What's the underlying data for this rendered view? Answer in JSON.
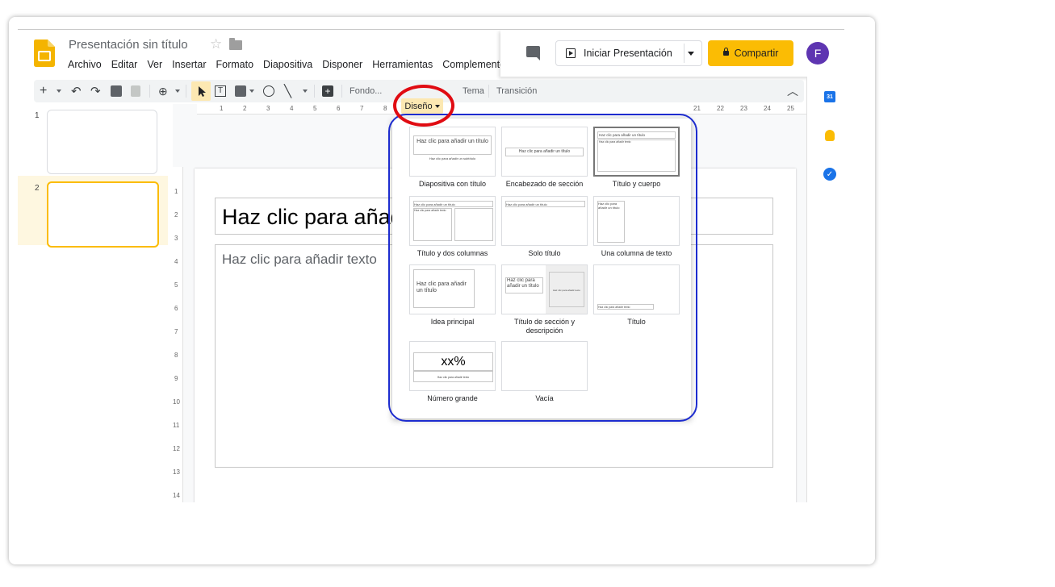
{
  "header": {
    "doc_title": "Presentación sin título",
    "menu": [
      "Archivo",
      "Editar",
      "Ver",
      "Insertar",
      "Formato",
      "Diapositiva",
      "Disponer",
      "Herramientas",
      "Complementos"
    ]
  },
  "actions": {
    "present_label": "Iniciar Presentación",
    "share_label": "Compartir",
    "avatar_letter": "F"
  },
  "toolbar": {
    "fondo_label": "Fondo...",
    "diseno_label": "Diseño",
    "tema_label": "Tema",
    "transicion_label": "Transición"
  },
  "filmstrip": {
    "slides": [
      {
        "number": "1"
      },
      {
        "number": "2"
      }
    ]
  },
  "ruler": {
    "top_ticks": [
      "1",
      "2",
      "3",
      "4",
      "5",
      "6",
      "7",
      "8",
      "21",
      "22",
      "23",
      "24",
      "25"
    ],
    "left_ticks": [
      "1",
      "2",
      "3",
      "4",
      "5",
      "6",
      "7",
      "8",
      "9",
      "10",
      "11",
      "12",
      "13",
      "14"
    ]
  },
  "slide": {
    "title_placeholder": "Haz clic para añadir un título",
    "body_placeholder": "Haz clic para añadir texto"
  },
  "layouts": {
    "items": [
      {
        "label": "Diapositiva con título",
        "preview_title": "Haz clic para añadir un título",
        "preview_sub": "Haz clic para añadir un subtítulo"
      },
      {
        "label": "Encabezado de sección",
        "preview_title": "Haz clic para añadir un título"
      },
      {
        "label": "Título y cuerpo",
        "preview_title": "Haz clic para añadir un título",
        "preview_sub": "Haz clic para añadir texto"
      },
      {
        "label": "Título y dos columnas",
        "preview_title": "Haz clic para añadir un título",
        "preview_sub": "Haz clic para añadir texto"
      },
      {
        "label": "Solo título",
        "preview_title": "Haz clic para añadir un título"
      },
      {
        "label": "Una columna de texto",
        "preview_title": "Haz clic para añadir un título"
      },
      {
        "label": "Idea principal",
        "preview_title": "Haz clic para añadir un título"
      },
      {
        "label": "Título de sección y descripción",
        "preview_title": "Haz clic para añadir un título",
        "preview_sub": "Haz clic para añadir texto"
      },
      {
        "label": "Título",
        "preview_sub": "Haz clic para añadir texto"
      },
      {
        "label": "Número grande",
        "preview_title": "xx%",
        "preview_sub": "Haz clic para añadir texto"
      },
      {
        "label": "Vacía"
      }
    ]
  },
  "colors": {
    "accent": "#fbbc04",
    "highlight_circle_red": "#e00b12",
    "highlight_circle_blue": "#1d2ccf",
    "avatar": "#5e35b1"
  }
}
